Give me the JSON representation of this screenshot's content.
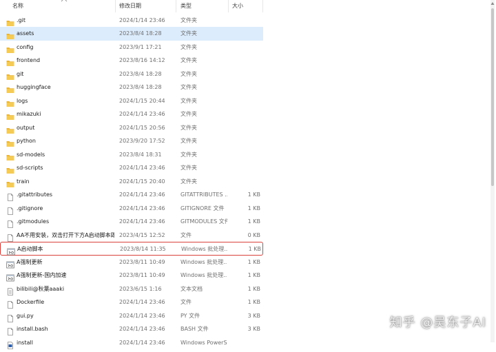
{
  "header": {
    "name": "名称",
    "date": "修改日期",
    "type": "类型",
    "size": "大小"
  },
  "files": [
    {
      "name": ".git",
      "date": "2024/1/14 23:46",
      "type": "文件夹",
      "size": "",
      "icon": "folder-icon"
    },
    {
      "name": "assets",
      "date": "2023/8/4 18:28",
      "type": "文件夹",
      "size": "",
      "icon": "folder-icon",
      "selected": true
    },
    {
      "name": "config",
      "date": "2023/9/1 17:21",
      "type": "文件夹",
      "size": "",
      "icon": "folder-icon"
    },
    {
      "name": "frontend",
      "date": "2023/8/16 14:12",
      "type": "文件夹",
      "size": "",
      "icon": "folder-icon"
    },
    {
      "name": "git",
      "date": "2023/8/4 18:28",
      "type": "文件夹",
      "size": "",
      "icon": "folder-icon"
    },
    {
      "name": "huggingface",
      "date": "2023/8/4 18:28",
      "type": "文件夹",
      "size": "",
      "icon": "folder-icon"
    },
    {
      "name": "logs",
      "date": "2024/1/15 20:44",
      "type": "文件夹",
      "size": "",
      "icon": "folder-icon"
    },
    {
      "name": "mikazuki",
      "date": "2024/1/14 23:46",
      "type": "文件夹",
      "size": "",
      "icon": "folder-icon"
    },
    {
      "name": "output",
      "date": "2024/1/15 20:56",
      "type": "文件夹",
      "size": "",
      "icon": "folder-icon"
    },
    {
      "name": "python",
      "date": "2023/9/20 17:52",
      "type": "文件夹",
      "size": "",
      "icon": "folder-icon"
    },
    {
      "name": "sd-models",
      "date": "2023/8/4 18:31",
      "type": "文件夹",
      "size": "",
      "icon": "folder-icon"
    },
    {
      "name": "sd-scripts",
      "date": "2024/1/14 23:46",
      "type": "文件夹",
      "size": "",
      "icon": "folder-icon"
    },
    {
      "name": "train",
      "date": "2024/1/15 20:40",
      "type": "文件夹",
      "size": "",
      "icon": "folder-icon"
    },
    {
      "name": ".gitattributes",
      "date": "2024/1/14 23:46",
      "type": "GITATTRIBUTES ...",
      "size": "1 KB",
      "icon": "file-icon"
    },
    {
      "name": ".gitignore",
      "date": "2024/1/14 23:46",
      "type": "GITIGNORE 文件",
      "size": "1 KB",
      "icon": "file-icon"
    },
    {
      "name": ".gitmodules",
      "date": "2024/1/14 23:46",
      "type": "GITMODULES 文件",
      "size": "1 KB",
      "icon": "file-icon"
    },
    {
      "name": "AA不用安装，双击打开下方A启动脚本即...",
      "date": "2023/4/15 12:52",
      "type": "文件",
      "size": "0 KB",
      "icon": "file-icon"
    },
    {
      "name": "A启动脚本",
      "date": "2023/8/14 11:35",
      "type": "Windows 批处理...",
      "size": "1 KB",
      "icon": "batch-file-icon",
      "highlighted": true
    },
    {
      "name": "A强制更新",
      "date": "2023/8/11 10:49",
      "type": "Windows 批处理...",
      "size": "1 KB",
      "icon": "batch-file-icon"
    },
    {
      "name": "A强制更新-国内加速",
      "date": "2023/8/11 10:49",
      "type": "Windows 批处理...",
      "size": "1 KB",
      "icon": "batch-file-icon"
    },
    {
      "name": "bilibili@秋葉aaaki",
      "date": "2023/6/15 1:16",
      "type": "文本文档",
      "size": "1 KB",
      "icon": "text-file-icon"
    },
    {
      "name": "Dockerfile",
      "date": "2024/1/14 23:46",
      "type": "文件",
      "size": "1 KB",
      "icon": "file-icon"
    },
    {
      "name": "gui.py",
      "date": "2024/1/14 23:46",
      "type": "PY 文件",
      "size": "3 KB",
      "icon": "file-icon"
    },
    {
      "name": "install.bash",
      "date": "2024/1/14 23:46",
      "type": "BASH 文件",
      "size": "3 KB",
      "icon": "file-icon"
    },
    {
      "name": "install",
      "date": "2024/1/14 23:46",
      "type": "Windows PowerS...",
      "size": "",
      "icon": "powershell-file-icon"
    }
  ],
  "watermark": "知乎 @吴东子AI",
  "colors": {
    "folder": "#f3c24a",
    "selection": "#dcecfc",
    "highlight_border": "#d9403a"
  }
}
